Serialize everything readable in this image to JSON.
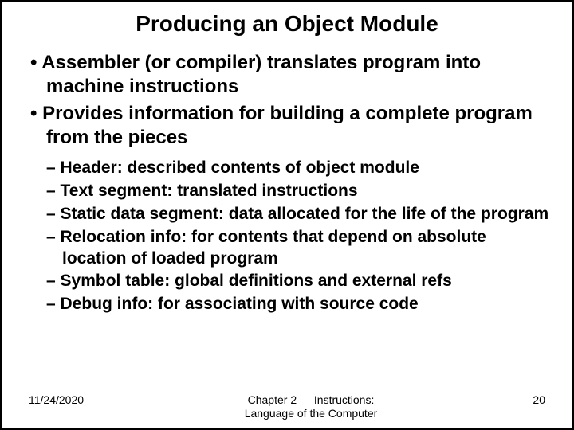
{
  "title": "Producing an Object Module",
  "bullets": [
    "Assembler (or compiler) translates program into machine instructions",
    "Provides information for building a complete program from the pieces"
  ],
  "subbullets": [
    "Header: described contents of object module",
    "Text segment: translated instructions",
    "Static data segment: data allocated for the life of the program",
    "Relocation info: for contents that depend on absolute location of loaded program",
    "Symbol table: global definitions and external refs",
    "Debug info: for associating with source code"
  ],
  "footer": {
    "date": "11/24/2020",
    "center_line1": "Chapter 2 — Instructions:",
    "center_line2": "Language of the Computer",
    "page": "20"
  }
}
